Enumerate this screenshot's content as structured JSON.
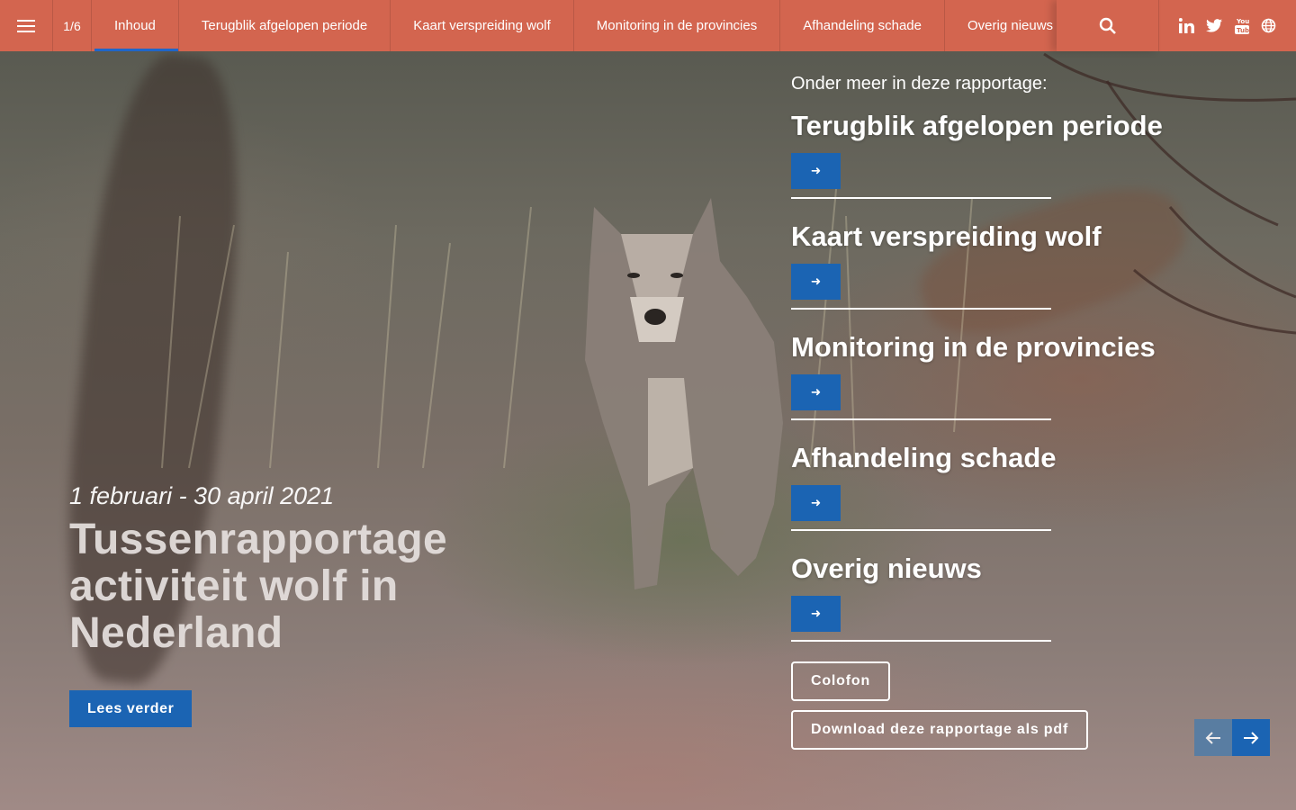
{
  "nav": {
    "page_counter": "1/6",
    "tabs": [
      {
        "label": "Inhoud",
        "active": true
      },
      {
        "label": "Terugblik afgelopen periode"
      },
      {
        "label": "Kaart verspreiding wolf"
      },
      {
        "label": "Monitoring in de provincies"
      },
      {
        "label": "Afhandeling schade"
      },
      {
        "label": "Overig nieuws"
      }
    ],
    "icons": {
      "menu": "hamburger-menu-icon",
      "search": "search-icon",
      "social": [
        "linkedin-icon",
        "twitter-icon",
        "youtube-icon",
        "globe-icon"
      ]
    },
    "color": "#d3654f",
    "active_indicator_color": "#1f66c9"
  },
  "hero": {
    "date_range": "1 februari - 30 april 2021",
    "title": "Tussenrapportage activiteit wolf in Nederland",
    "read_more_label": "Lees verder"
  },
  "toc": {
    "intro": "Onder meer in deze rapportage:",
    "items": [
      {
        "title": "Terugblik afgelopen periode"
      },
      {
        "title": "Kaart verspreiding wolf"
      },
      {
        "title": "Monitoring in de provincies"
      },
      {
        "title": "Afhandeling schade"
      },
      {
        "title": "Overig nieuws"
      }
    ],
    "arrow_glyph": "➜"
  },
  "actions": {
    "colofon_label": "Colofon",
    "download_label": "Download deze rapportage als pdf"
  },
  "colors": {
    "button_blue": "#1b64b3"
  }
}
